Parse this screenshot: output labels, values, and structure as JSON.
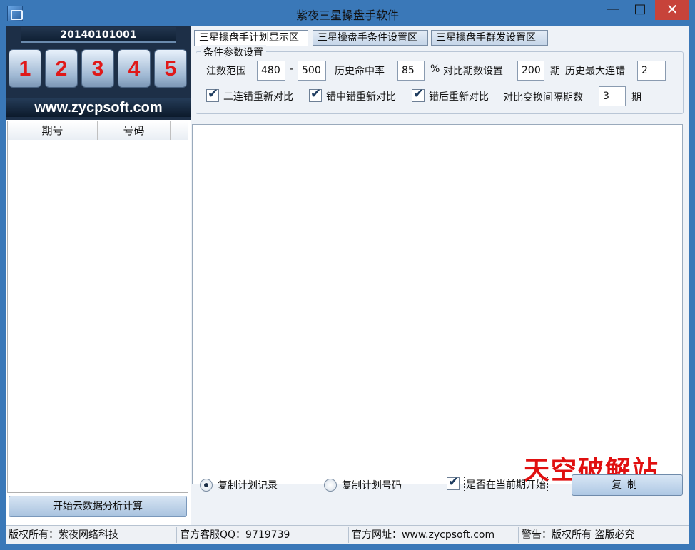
{
  "window": {
    "title": "紫夜三星操盘手软件",
    "min_glyph": "—",
    "max_glyph": "□",
    "close_glyph": "✕"
  },
  "left": {
    "issue_number": "20140101001",
    "balls": [
      "1",
      "2",
      "3",
      "4",
      "5"
    ],
    "site_url": "www.zycpsoft.com",
    "columns": [
      "期号",
      "号码"
    ],
    "start_button": "开始云数据分析计算"
  },
  "tabs": [
    "三星操盘手计划显示区",
    "三星操盘手条件设置区",
    "三星操盘手群发设置区"
  ],
  "conditions": {
    "group_title": "条件参数设置",
    "bet_range_label": "注数范围",
    "bet_min": "480",
    "dash": "-",
    "bet_max": "500",
    "hit_rate_label": "历史命中率",
    "hit_rate": "85",
    "percent": "%",
    "compare_periods_label": "对比期数设置",
    "compare_periods": "200",
    "period_unit": "期",
    "max_miss_label": "历史最大连错",
    "max_miss": "2",
    "checkbox_1": "二连错重新对比",
    "checkbox_2": "错中错重新对比",
    "checkbox_3": "错后重新对比",
    "interval_label": "对比变换间隔期数",
    "interval": "3",
    "interval_unit": "期"
  },
  "output": {
    "watermark": "天空破解站"
  },
  "bottom": {
    "radio_1": "复制计划记录",
    "radio_2": "复制计划号码",
    "checkbox": "是否在当前期开始",
    "copy_button": "复制"
  },
  "status": {
    "copyright": "版权所有：紫夜网络科技",
    "qq": "官方客服QQ：9719739",
    "website": "官方网址：www.zycpsoft.com",
    "warning": "警告：版权所有 盗版必究"
  }
}
